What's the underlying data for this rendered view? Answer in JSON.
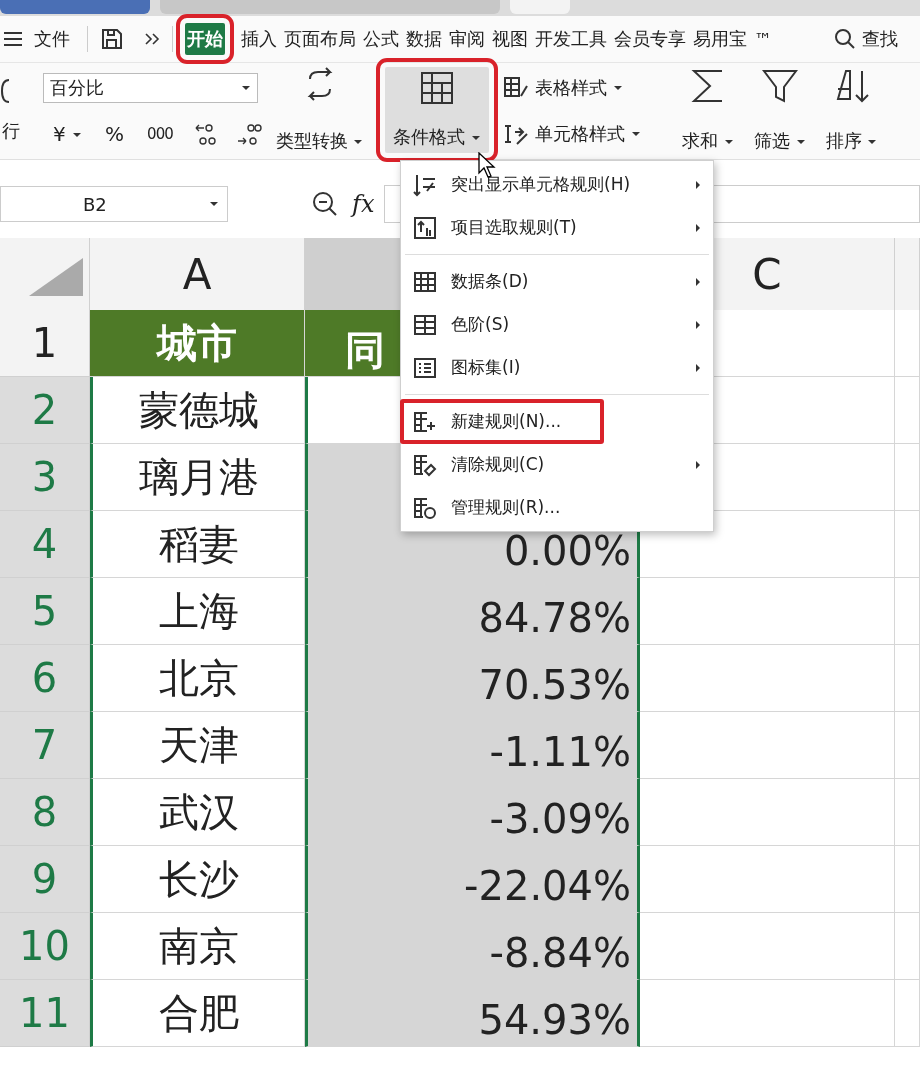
{
  "menu_bar": {
    "items": [
      {
        "label": "文件",
        "kind": "menu"
      },
      {
        "label": "开始",
        "kind": "tab",
        "selected": true,
        "outlined": true
      },
      {
        "label": "插入",
        "kind": "tab",
        "selected": false,
        "outlined": false
      },
      {
        "label": "页面布局",
        "kind": "tab",
        "selected": false,
        "outlined": false
      },
      {
        "label": "公式",
        "kind": "tab",
        "selected": false,
        "outlined": false
      },
      {
        "label": "数据",
        "kind": "tab",
        "selected": false,
        "outlined": false
      },
      {
        "label": "审阅",
        "kind": "tab",
        "selected": false,
        "outlined": false
      },
      {
        "label": "视图",
        "kind": "tab",
        "selected": false,
        "outlined": false
      },
      {
        "label": "开发工具",
        "kind": "tab",
        "selected": false,
        "outlined": false
      },
      {
        "label": "会员专享",
        "kind": "tab",
        "selected": false,
        "outlined": false
      },
      {
        "label": "易用宝",
        "kind": "tab",
        "selected": false,
        "outlined": false
      },
      {
        "label": "™",
        "kind": "tab",
        "selected": false,
        "outlined": false
      }
    ],
    "search": "查找"
  },
  "ribbon": {
    "wrap_label": "行",
    "number_format": "百分比",
    "currency": "¥",
    "percent": "%",
    "thousands": "000",
    "convert": "类型转换",
    "conditional_format": {
      "label": "条件格式",
      "outlined": true
    },
    "table_style": "表格样式",
    "cell_style": "单元格样式",
    "sum": "求和",
    "filter": "筛选",
    "sort": "排序"
  },
  "formula_bar": {
    "name_box": "B2",
    "fx": "fx"
  },
  "grid": {
    "columns": [
      {
        "label": "A",
        "selected": false
      },
      {
        "selected": true
      },
      {
        "label": "C",
        "selected": false
      }
    ],
    "rows": [
      {
        "header": "1",
        "kind": "header",
        "selected": false,
        "city": "城市",
        "value": "同"
      },
      {
        "header": "2",
        "kind": "data",
        "selected": true,
        "active": true,
        "city": "蒙德城"
      },
      {
        "header": "3",
        "kind": "data",
        "selected": true,
        "active": false,
        "city": "璃月港"
      },
      {
        "header": "4",
        "kind": "data",
        "selected": true,
        "active": false,
        "city": "稻妻",
        "value": "0.00%"
      },
      {
        "header": "5",
        "kind": "data",
        "selected": true,
        "active": false,
        "city": "上海",
        "value": "84.78%"
      },
      {
        "header": "6",
        "kind": "data",
        "selected": true,
        "active": false,
        "city": "北京",
        "value": "70.53%"
      },
      {
        "header": "7",
        "kind": "data",
        "selected": true,
        "active": false,
        "city": "天津",
        "value": "-1.11%"
      },
      {
        "header": "8",
        "kind": "data",
        "selected": true,
        "active": false,
        "city": "武汉",
        "value": "-3.09%"
      },
      {
        "header": "9",
        "kind": "data",
        "selected": true,
        "active": false,
        "city": "长沙",
        "value": "-22.04%"
      },
      {
        "header": "10",
        "kind": "data",
        "selected": true,
        "active": false,
        "city": "南京",
        "value": "-8.84%"
      },
      {
        "header": "11",
        "kind": "data",
        "selected": true,
        "active": false,
        "city": "合肥",
        "value": "54.93%"
      }
    ]
  },
  "context_menu": {
    "items": [
      {
        "kind": "item",
        "label": "突出显示单元格规则(H)",
        "submenu": true,
        "outlined": false
      },
      {
        "kind": "item",
        "label": "项目选取规则(T)",
        "submenu": true,
        "outlined": false
      },
      {
        "kind": "separator"
      },
      {
        "kind": "item",
        "label": "数据条(D)",
        "submenu": true,
        "outlined": false
      },
      {
        "kind": "item",
        "label": "色阶(S)",
        "submenu": true,
        "outlined": false
      },
      {
        "kind": "item",
        "label": "图标集(I)",
        "submenu": true,
        "outlined": false
      },
      {
        "kind": "separator"
      },
      {
        "kind": "item",
        "label": "新建规则(N)...",
        "submenu": false,
        "outlined": true
      },
      {
        "kind": "item",
        "label": "清除规则(C)",
        "submenu": true,
        "outlined": false
      },
      {
        "kind": "item",
        "label": "管理规则(R)...",
        "submenu": false,
        "outlined": false
      }
    ]
  }
}
